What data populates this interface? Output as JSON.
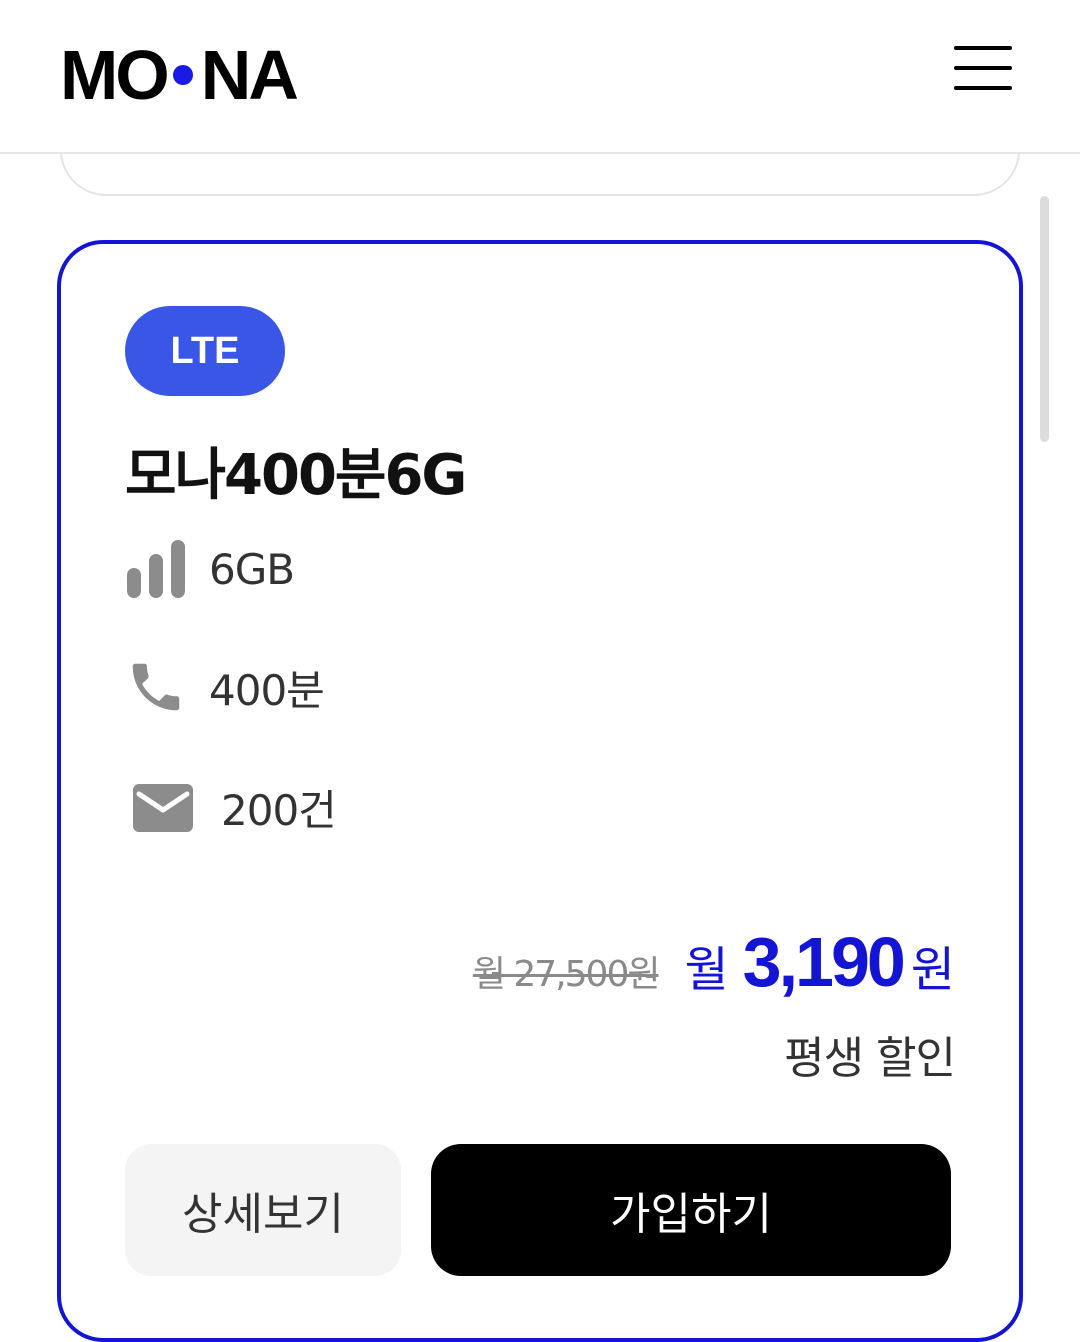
{
  "header": {
    "logo_left": "MO",
    "logo_right": "NA",
    "menu_icon": "hamburger-menu-icon"
  },
  "card": {
    "badge": "LTE",
    "plan_name": "모나400분6G",
    "features": [
      {
        "icon": "signal-bars-icon",
        "value": "6GB"
      },
      {
        "icon": "phone-icon",
        "value": "400분"
      },
      {
        "icon": "mail-icon",
        "value": "200건"
      }
    ],
    "original_price": "월 27,500원",
    "price_prefix": "월",
    "price_amount": "3,190",
    "price_suffix": "원",
    "discount_label": "평생 할인",
    "detail_button": "상세보기",
    "join_button": "가입하기"
  },
  "colors": {
    "accent": "#1414d4",
    "badge": "#3a56e6",
    "icon_gray": "#8c8c8c"
  }
}
